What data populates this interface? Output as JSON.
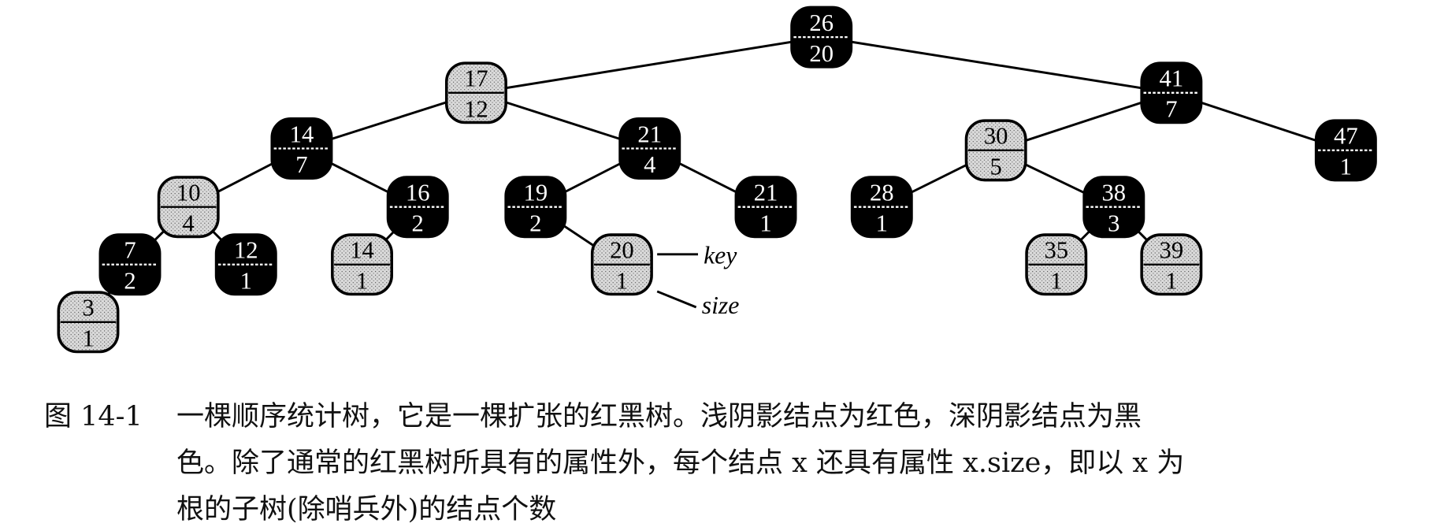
{
  "nodes": [
    {
      "id": 0,
      "key": "26",
      "size": "20",
      "color": "black",
      "parent": null
    },
    {
      "id": 1,
      "key": "17",
      "size": "12",
      "color": "red",
      "parent": 0
    },
    {
      "id": 2,
      "key": "41",
      "size": "7",
      "color": "black",
      "parent": 0
    },
    {
      "id": 3,
      "key": "14",
      "size": "7",
      "color": "black",
      "parent": 1
    },
    {
      "id": 4,
      "key": "21",
      "size": "4",
      "color": "black",
      "parent": 1
    },
    {
      "id": 5,
      "key": "30",
      "size": "5",
      "color": "red",
      "parent": 2
    },
    {
      "id": 6,
      "key": "47",
      "size": "1",
      "color": "black",
      "parent": 2
    },
    {
      "id": 7,
      "key": "10",
      "size": "4",
      "color": "red",
      "parent": 3
    },
    {
      "id": 8,
      "key": "16",
      "size": "2",
      "color": "black",
      "parent": 3
    },
    {
      "id": 9,
      "key": "19",
      "size": "2",
      "color": "black",
      "parent": 4
    },
    {
      "id": 10,
      "key": "21",
      "size": "1",
      "color": "black",
      "parent": 4
    },
    {
      "id": 11,
      "key": "28",
      "size": "1",
      "color": "black",
      "parent": 5
    },
    {
      "id": 12,
      "key": "38",
      "size": "3",
      "color": "black",
      "parent": 5
    },
    {
      "id": 13,
      "key": "7",
      "size": "2",
      "color": "black",
      "parent": 7
    },
    {
      "id": 14,
      "key": "12",
      "size": "1",
      "color": "black",
      "parent": 7
    },
    {
      "id": 15,
      "key": "14",
      "size": "1",
      "color": "red",
      "parent": 8
    },
    {
      "id": 16,
      "key": "20",
      "size": "1",
      "color": "red",
      "parent": 9
    },
    {
      "id": 17,
      "key": "35",
      "size": "1",
      "color": "red",
      "parent": 12
    },
    {
      "id": 18,
      "key": "39",
      "size": "1",
      "color": "red",
      "parent": 12
    },
    {
      "id": 19,
      "key": "3",
      "size": "1",
      "color": "red",
      "parent": 13
    }
  ],
  "legend": {
    "key_label": "key",
    "size_label": "size"
  },
  "colors": {
    "black_node": "#000000",
    "red_node_shade": "#cfcfcf"
  },
  "caption": {
    "number": "图 14-1",
    "lines": [
      "一棵顺序统计树，它是一棵扩张的红黑树。浅阴影结点为红色，深阴影结点为黑",
      "色。除了通常的红黑树所具有的属性外，每个结点 x 还具有属性 x.size，即以 x 为",
      "根的子树(除哨兵外)的结点个数"
    ]
  }
}
